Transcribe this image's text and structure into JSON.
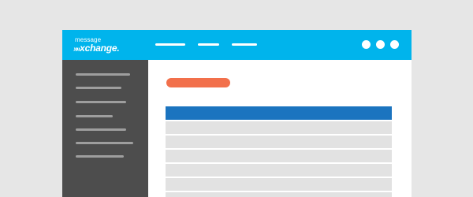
{
  "app": {
    "logo_top": "message",
    "logo_arrows": "»»",
    "logo_bottom": "xchange.",
    "brand_color": "#00b4ec",
    "accent_color": "#f2704b",
    "table_header_color": "#1b74bf",
    "sidebar_color": "#4d4d4d"
  },
  "header": {
    "nav_items": [
      "placeholder-line",
      "placeholder-line",
      "placeholder-line"
    ],
    "window_controls": [
      "dot",
      "dot",
      "dot"
    ]
  },
  "sidebar": {
    "items": [
      "placeholder-line",
      "placeholder-line",
      "placeholder-line",
      "placeholder-line",
      "placeholder-line",
      "placeholder-line",
      "placeholder-line"
    ]
  },
  "main": {
    "action_button": "placeholder-pill",
    "table": {
      "header": "placeholder-header",
      "rows": [
        "row",
        "row",
        "row",
        "row",
        "row",
        "row"
      ]
    }
  }
}
